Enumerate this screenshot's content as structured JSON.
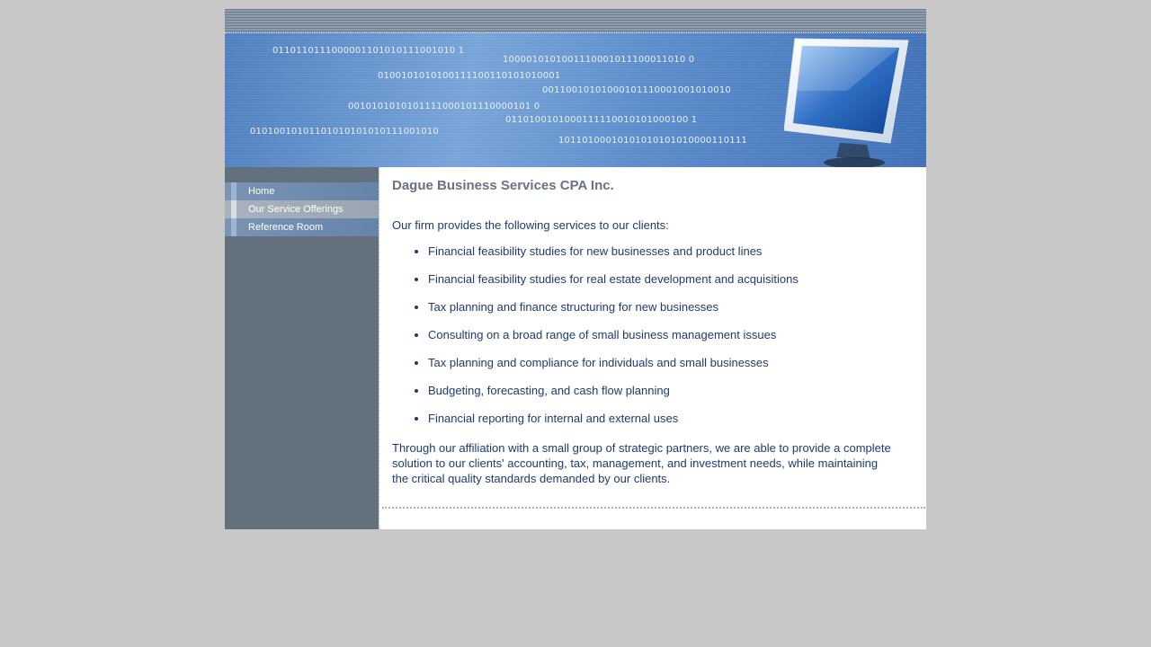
{
  "header": {
    "binary_lines": [
      "0110110111000001101010111001010 1",
      "1000010101001110001011100011010 0",
      "0100101010100111100110101010001",
      "00110010101000101110001001010010",
      "0010101010101111000101110000101 0",
      "0110100101000111110010101000100 1",
      "01010010101101010101010111001010",
      "10110100010101010101010000110111"
    ],
    "monitor_icon": "computer-monitor-icon"
  },
  "sidebar": {
    "items": [
      {
        "label": "Home",
        "active": false
      },
      {
        "label": "Our Service Offerings",
        "active": true
      },
      {
        "label": "Reference Room",
        "active": false
      }
    ]
  },
  "main": {
    "title": "Dague Business Services CPA Inc.",
    "intro": "Our firm provides the following services to our clients:",
    "services": [
      "Financial feasibility studies for new businesses and product lines",
      "Financial feasibility studies for real estate development and acquisitions",
      "Tax planning and finance structuring for new businesses",
      "Consulting on a broad range of small business management issues",
      "Tax planning and compliance for individuals and small businesses",
      "Budgeting, forecasting, and cash flow planning",
      "Financial reporting for internal and external uses"
    ],
    "closing": "Through our affiliation with a small group of strategic partners, we are able to provide a complete solution to our clients' accounting, tax, management, and investment needs, while maintaining the critical quality standards demanded by our clients."
  },
  "colors": {
    "page_bg": "#c8c8c8",
    "sidebar_bg": "#63717f",
    "text_blue": "#1f3a6e",
    "title_gray": "#677380"
  }
}
